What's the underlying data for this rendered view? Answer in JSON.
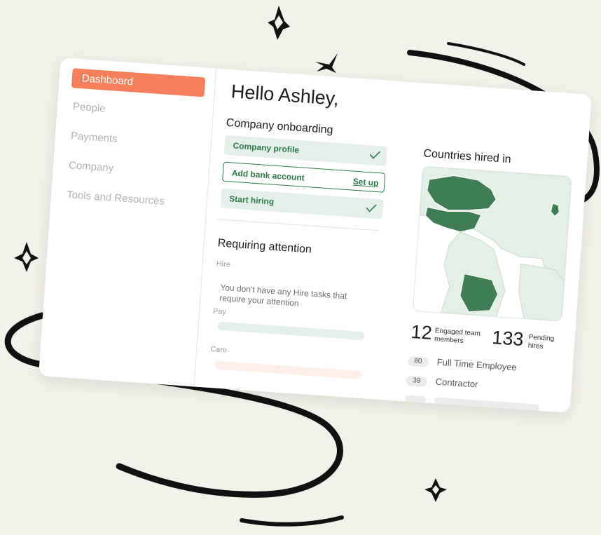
{
  "sidebar": {
    "items": [
      {
        "label": "Dashboard",
        "active": true
      },
      {
        "label": "People"
      },
      {
        "label": "Payments"
      },
      {
        "label": "Company"
      },
      {
        "label": "Tools and Resources"
      }
    ]
  },
  "main": {
    "greeting": "Hello Ashley,",
    "onboarding": {
      "title": "Company onboarding",
      "tasks": [
        {
          "label": "Company profile",
          "status": "done"
        },
        {
          "label": "Add bank account",
          "action": "Set up"
        },
        {
          "label": "Start hiring",
          "status": "done"
        }
      ]
    },
    "attention": {
      "title": "Requiring attention",
      "hire_label": "Hire",
      "hire_message": "You don't have any Hire tasks that require your attention",
      "pay_label": "Pay",
      "care_label": "Care"
    }
  },
  "countries": {
    "title": "Countries hired in",
    "engaged": {
      "number": "12",
      "label": "Engaged team members"
    },
    "pending": {
      "number": "133",
      "label": "Pending hires"
    },
    "types": [
      {
        "count": "80",
        "label": "Full Time Employee"
      },
      {
        "count": "39",
        "label": "Contractor"
      }
    ]
  },
  "colors": {
    "accent": "#f47f5a",
    "green": "#2d7a4a",
    "map_highlight": "#3f7d55",
    "map_base": "#e4efe6",
    "background": "#f3f2ea"
  }
}
